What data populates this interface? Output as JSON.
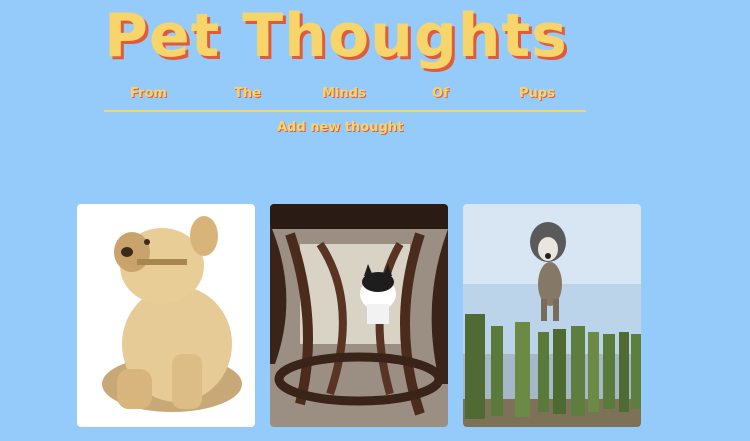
{
  "header": {
    "title": "Pet Thoughts",
    "tagline_words": [
      "From",
      "The",
      "Minds",
      "Of",
      "Pups"
    ],
    "add_link": "Add new thought"
  },
  "cards": [
    {
      "subject": "golden-puppy-statue"
    },
    {
      "subject": "kitten-under-table"
    },
    {
      "subject": "dog-jumping-at-beach"
    }
  ],
  "colors": {
    "background": "#94cbfa",
    "title": "#f7d56a",
    "title_shadow": "#e25a3a"
  }
}
